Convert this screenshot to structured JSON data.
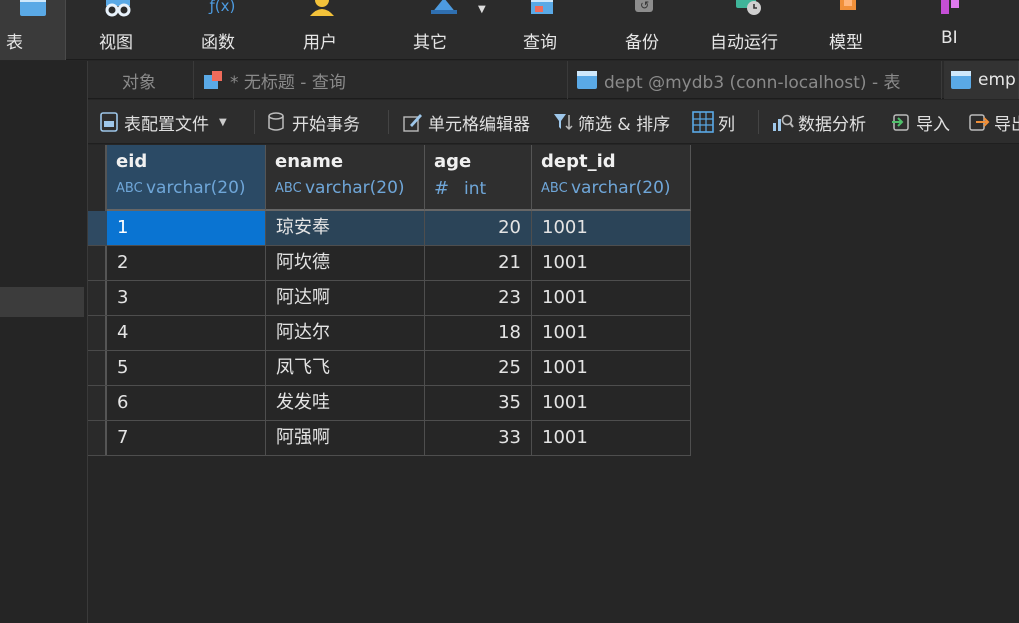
{
  "ribbon": {
    "items": [
      {
        "label": "表",
        "icon": "table-icon"
      },
      {
        "label": "视图",
        "icon": "view-icon"
      },
      {
        "label": "函数",
        "icon": "function-icon"
      },
      {
        "label": "用户",
        "icon": "user-icon"
      },
      {
        "label": "其它",
        "icon": "other-icon"
      },
      {
        "label": "查询",
        "icon": "query-icon"
      },
      {
        "label": "备份",
        "icon": "backup-icon"
      },
      {
        "label": "自动运行",
        "icon": "auto-run-icon"
      },
      {
        "label": "模型",
        "icon": "model-icon"
      },
      {
        "label": "BI",
        "icon": "bi-icon"
      }
    ]
  },
  "tabs": [
    {
      "label": "对象"
    },
    {
      "label": "* 无标题 - 查询"
    },
    {
      "label": "dept @mydb3 (conn-localhost) - 表"
    },
    {
      "label": "emp"
    }
  ],
  "toolbar": {
    "table_config": "表配置文件",
    "begin_transaction": "开始事务",
    "cell_editor": "单元格编辑器",
    "filter_sort": "筛选 & 排序",
    "columns": "列",
    "data_analysis": "数据分析",
    "import": "导入",
    "export": "导出"
  },
  "grid": {
    "columns": [
      {
        "name": "eid",
        "type": "varchar(20)",
        "type_glyph": "ABC"
      },
      {
        "name": "ename",
        "type": "varchar(20)",
        "type_glyph": "ABC"
      },
      {
        "name": "age",
        "type": "int",
        "type_glyph": "#"
      },
      {
        "name": "dept_id",
        "type": "varchar(20)",
        "type_glyph": "ABC"
      }
    ],
    "rows": [
      [
        "1",
        "琼安奉",
        "20",
        "1001"
      ],
      [
        "2",
        "阿坎德",
        "21",
        "1001"
      ],
      [
        "3",
        "阿达啊",
        "23",
        "1001"
      ],
      [
        "4",
        "阿达尔",
        "18",
        "1001"
      ],
      [
        "5",
        "凤飞飞",
        "25",
        "1001"
      ],
      [
        "6",
        "发发哇",
        "35",
        "1001"
      ],
      [
        "7",
        "阿强啊",
        "33",
        "1001"
      ]
    ]
  },
  "colors": {
    "accent": "#0a74d2",
    "type_text": "#6fa6d8",
    "selected_row": "#2b4458"
  }
}
